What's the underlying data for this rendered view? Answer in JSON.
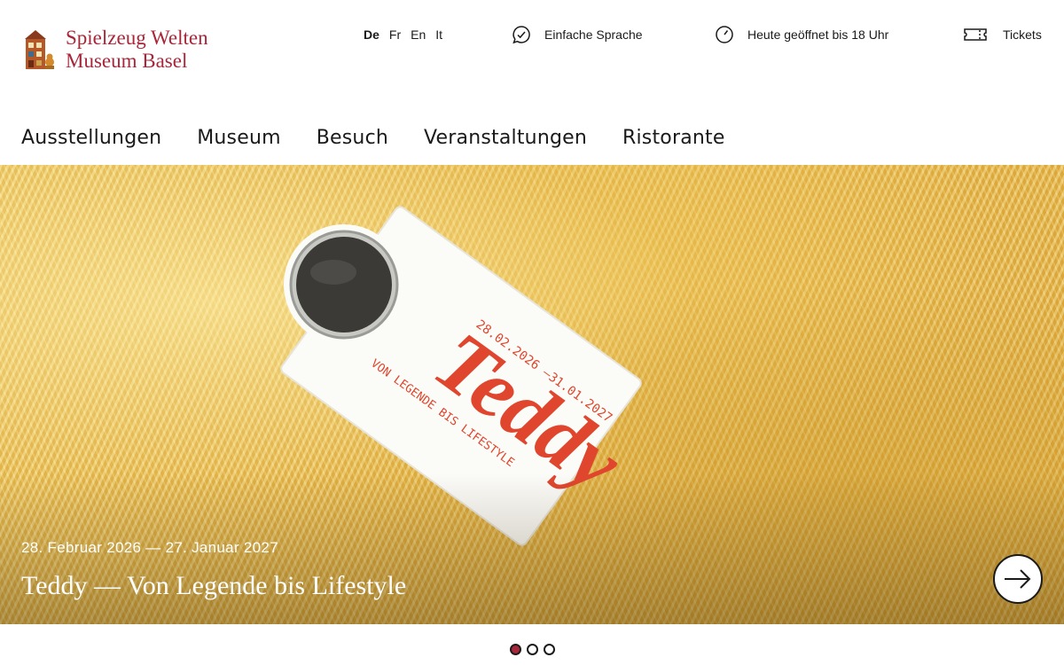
{
  "brand": {
    "line1": "Spielzeug Welten",
    "line2": "Museum Basel",
    "color": "#a8263a"
  },
  "languages": [
    {
      "label": "De",
      "active": true
    },
    {
      "label": "Fr",
      "active": false
    },
    {
      "label": "En",
      "active": false
    },
    {
      "label": "It",
      "active": false
    }
  ],
  "utility": {
    "easy_language": {
      "label": "Einfache Sprache",
      "icon": "speech-bubble-check-icon"
    },
    "hours": {
      "label": "Heute geöffnet bis 18 Uhr",
      "icon": "clock-icon"
    },
    "tickets": {
      "label": "Tickets",
      "icon": "ticket-icon"
    }
  },
  "nav": {
    "items": [
      "Ausstellungen",
      "Museum",
      "Besuch",
      "Veranstaltungen",
      "Ristorante"
    ]
  },
  "hero": {
    "date": "28. Februar 2026 — 27. Januar 2027",
    "title": "Teddy — Von Legende bis Lifestyle",
    "label_brand": "Teddy",
    "label_dates": "28.02.2026 –31.01.2027",
    "label_subtitle": "VON LEGENDE BIS LIFESTYLE",
    "next_icon": "arrow-right-icon"
  },
  "carousel": {
    "slides": 3,
    "active_index": 0
  }
}
